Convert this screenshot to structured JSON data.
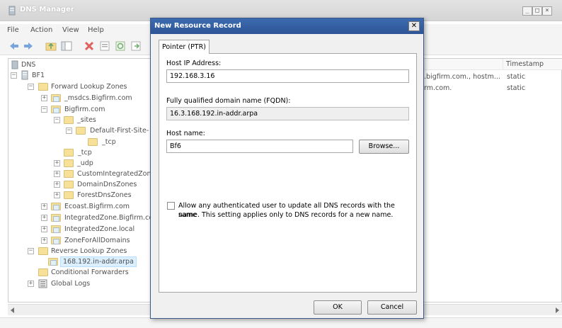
{
  "window": {
    "title": "DNS Manager"
  },
  "menu": [
    "File",
    "Action",
    "View",
    "Help"
  ],
  "tree": [
    {
      "label": "DNS"
    },
    {
      "label": "BF1"
    },
    {
      "label": "Forward Lookup Zones"
    },
    {
      "label": "_msdcs.Bigfirm.com"
    },
    {
      "label": "Bigfirm.com"
    },
    {
      "label": "_sites"
    },
    {
      "label": "Default-First-Site-"
    },
    {
      "label": "_tcp"
    },
    {
      "label": "_tcp"
    },
    {
      "label": "_udp"
    },
    {
      "label": "CustomIntegratedZon"
    },
    {
      "label": "DomainDnsZones"
    },
    {
      "label": "ForestDnsZones"
    },
    {
      "label": "Ecoast.Bigfirm.com"
    },
    {
      "label": "IntegratedZone.Bigfirm.cc"
    },
    {
      "label": "IntegratedZone.local"
    },
    {
      "label": "ZoneForAllDomains"
    },
    {
      "label": "Reverse Lookup Zones"
    },
    {
      "label": "168.192.in-addr.arpa"
    },
    {
      "label": "Conditional Forwarders"
    },
    {
      "label": "Global Logs"
    }
  ],
  "list": {
    "columns": [
      "Timestamp"
    ],
    "rows": [
      {
        "data": ".bigfirm.com., hostm...",
        "timestamp": "static"
      },
      {
        "data": "rm.com.",
        "timestamp": "static"
      }
    ]
  },
  "dialog": {
    "title": "New Resource Record",
    "close": "✕",
    "tab": "Pointer (PTR)",
    "host_ip_label": "Host IP Address:",
    "host_ip_value": "192.168.3.16",
    "fqdn_label": "Fully qualified domain name (FQDN):",
    "fqdn_value": "16.3.168.192.in-addr.arpa",
    "hostname_label": "Host name:",
    "hostname_value": "Bf6",
    "browse_label": "Browse...",
    "checkbox_text_line1": "Allow any authenticated user to update all DNS records with the same",
    "checkbox_text_line2": "name. This setting applies only to DNS records for a new name.",
    "checkbox_checked": false,
    "ok_label": "OK",
    "cancel_label": "Cancel"
  }
}
